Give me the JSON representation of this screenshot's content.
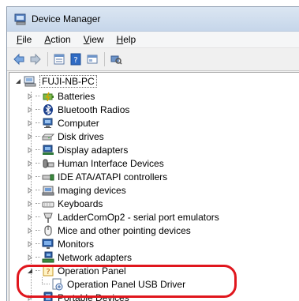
{
  "window": {
    "title": "Device Manager"
  },
  "menu": [
    {
      "label": "File",
      "accel": "F",
      "rest": "ile"
    },
    {
      "label": "Action",
      "accel": "A",
      "rest": "ction"
    },
    {
      "label": "View",
      "accel": "V",
      "rest": "iew"
    },
    {
      "label": "Help",
      "accel": "H",
      "rest": "elp"
    }
  ],
  "toolbar": {
    "buttons": [
      "back-arrow-icon",
      "forward-arrow-icon",
      "properties-icon",
      "help-icon",
      "update-driver-icon",
      "scan-hardware-icon"
    ]
  },
  "tree": {
    "root": {
      "label": "FUJI-NB-PC",
      "icon": "computer-icon"
    },
    "items": [
      {
        "label": "Batteries",
        "icon": "battery-icon"
      },
      {
        "label": "Bluetooth Radios",
        "icon": "bluetooth-icon"
      },
      {
        "label": "Computer",
        "icon": "computer-icon"
      },
      {
        "label": "Disk drives",
        "icon": "disk-drive-icon"
      },
      {
        "label": "Display adapters",
        "icon": "display-adapter-icon"
      },
      {
        "label": "Human Interface Devices",
        "icon": "hid-icon"
      },
      {
        "label": "IDE ATA/ATAPI controllers",
        "icon": "ide-controller-icon"
      },
      {
        "label": "Imaging devices",
        "icon": "imaging-device-icon"
      },
      {
        "label": "Keyboards",
        "icon": "keyboard-icon"
      },
      {
        "label": "LadderComOp2 - serial port emulators",
        "icon": "serial-port-icon"
      },
      {
        "label": "Mice and other pointing devices",
        "icon": "mouse-icon"
      },
      {
        "label": "Monitors",
        "icon": "monitor-icon"
      },
      {
        "label": "Network adapters",
        "icon": "network-adapter-icon"
      },
      {
        "label": "Operation Panel",
        "icon": "operation-panel-icon",
        "expanded": true,
        "children": [
          {
            "label": "Operation Panel USB Driver",
            "icon": "usb-driver-icon"
          }
        ]
      },
      {
        "label": "Portable Devices",
        "icon": "portable-device-icon"
      }
    ]
  },
  "highlight_color": "#e0161d"
}
